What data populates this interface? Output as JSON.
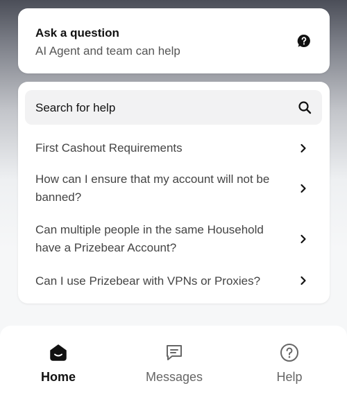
{
  "ask_card": {
    "title": "Ask a question",
    "subtitle": "AI Agent and team can help",
    "icon": "question-bubble-icon"
  },
  "help": {
    "search_label": "Search for help",
    "articles": [
      {
        "label": "First Cashout Requirements"
      },
      {
        "label": "How can I ensure that my account will not be banned?"
      },
      {
        "label": "Can multiple people in the same Household have a Prizebear Account?"
      },
      {
        "label": "Can I use Prizebear with VPNs or Proxies?"
      }
    ]
  },
  "nav": {
    "items": [
      {
        "label": "Home",
        "icon": "home-icon",
        "active": true
      },
      {
        "label": "Messages",
        "icon": "messages-icon",
        "active": false
      },
      {
        "label": "Help",
        "icon": "help-icon",
        "active": false
      }
    ]
  },
  "colors": {
    "card_bg": "#ffffff",
    "search_bg": "#f2f2f3",
    "text_primary": "#111111",
    "text_secondary": "#555555"
  }
}
